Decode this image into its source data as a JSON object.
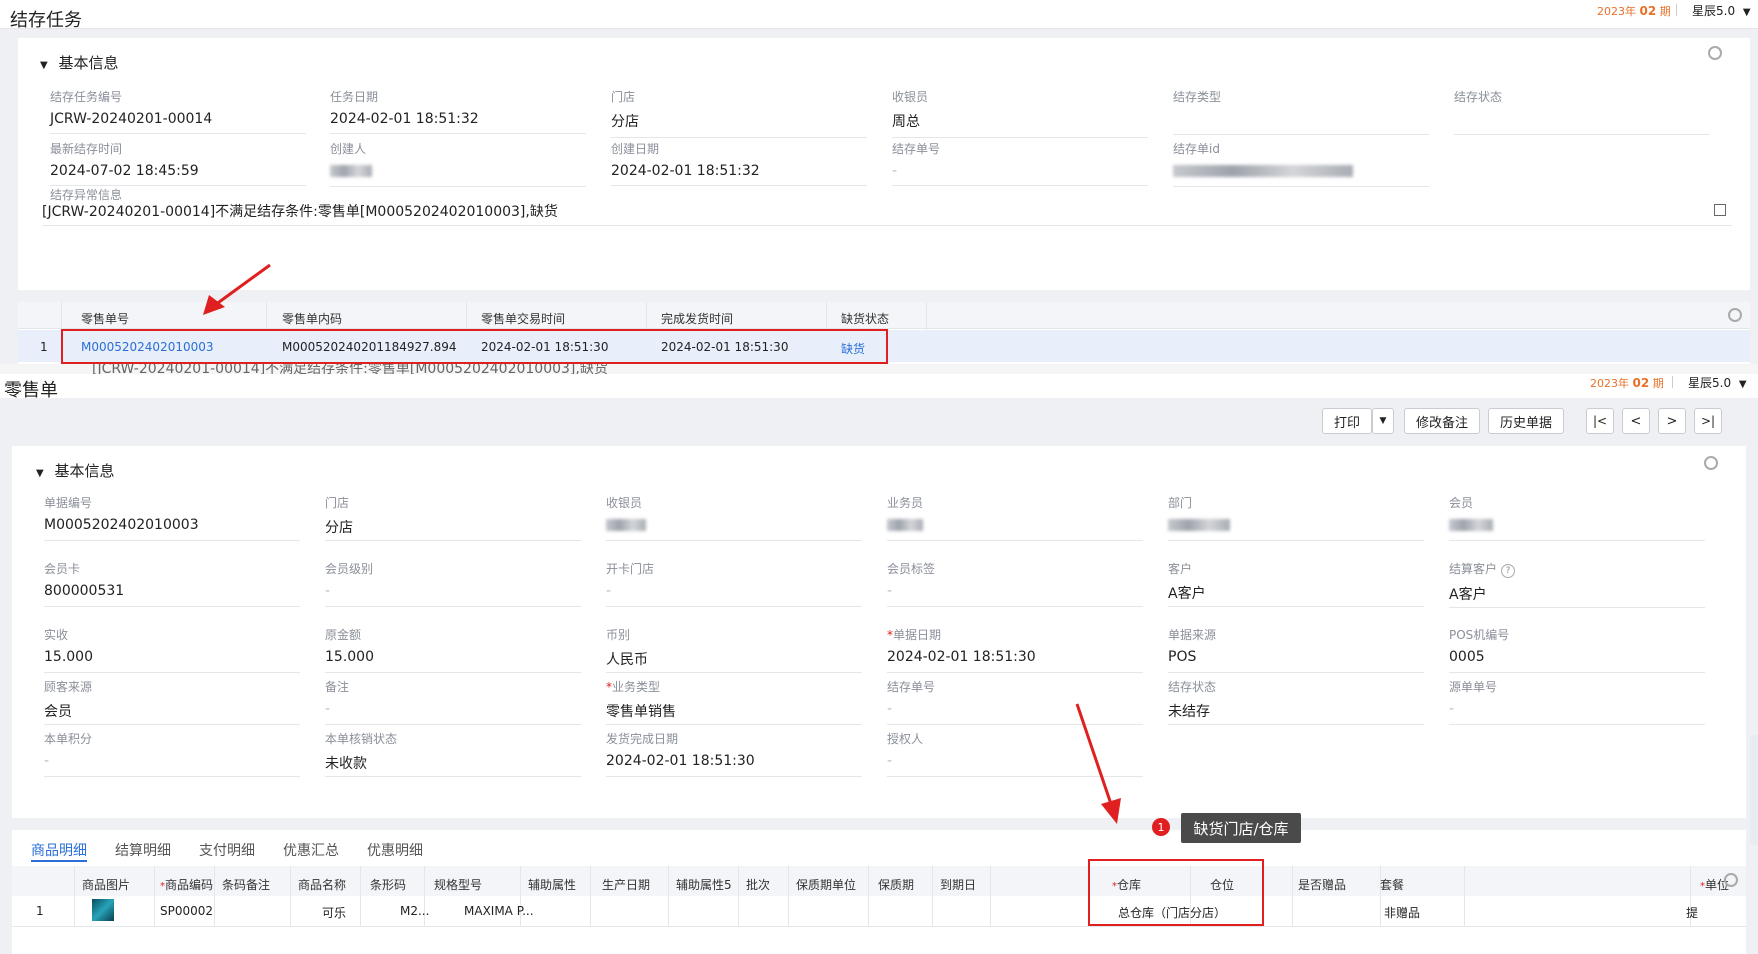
{
  "top": {
    "title": "结存任务",
    "period_year": "2023年",
    "period_num": "02",
    "period_unit": "期",
    "version": "星辰5.0",
    "section_title": "基本信息",
    "fields": [
      {
        "label": "结存任务编号",
        "value": "JCRW-20240201-00014"
      },
      {
        "label": "任务日期",
        "value": "2024-02-01 18:51:32"
      },
      {
        "label": "门店",
        "value": "分店"
      },
      {
        "label": "收银员",
        "value": "周总"
      },
      {
        "label": "结存类型",
        "value": ""
      },
      {
        "label": "结存状态",
        "value": ""
      },
      {
        "label": "最新结存时间",
        "value": "2024-07-02 18:45:59"
      },
      {
        "label": "创建人",
        "value": ""
      },
      {
        "label": "创建日期",
        "value": "2024-02-01 18:51:32"
      },
      {
        "label": "结存单号",
        "value": "-"
      },
      {
        "label": "结存单id",
        "value": ""
      }
    ],
    "error_label": "结存异常信息",
    "error_text": "[JCRW-20240201-00014]不满足结存条件:零售单[M0005202402010003],缺货",
    "table": {
      "headers": [
        "零售单号",
        "零售单内码",
        "零售单交易时间",
        "完成发货时间",
        "缺货状态"
      ],
      "rows": [
        {
          "index": "1",
          "order_no": "M0005202402010003",
          "inner_code": "M00052024020118492​7.894...",
          "trade_time": "2024-02-01 18:51:30",
          "ship_time": "2024-02-01 18:51:30",
          "status": "缺货"
        }
      ]
    },
    "overlap_text": "[JCRW-20240201-00014]不满足结存条件:零售单[M0005202402010003],缺货"
  },
  "bottom": {
    "title": "零售单",
    "period_year": "2023年",
    "period_num": "02",
    "period_unit": "期",
    "version": "星辰5.0",
    "toolbar": {
      "print": "打印",
      "edit_note": "修改备注",
      "history": "历史单据"
    },
    "section_title": "基本信息",
    "fields": [
      {
        "label": "单据编号",
        "value": "M0005202402010003"
      },
      {
        "label": "门店",
        "value": "分店"
      },
      {
        "label": "收银员",
        "value": ""
      },
      {
        "label": "业务员",
        "value": ""
      },
      {
        "label": "部门",
        "value": ""
      },
      {
        "label": "会员",
        "value": ""
      },
      {
        "label": "会员卡",
        "value": "800000531"
      },
      {
        "label": "会员级别",
        "value": "-"
      },
      {
        "label": "开卡门店",
        "value": "-"
      },
      {
        "label": "会员标签",
        "value": "-"
      },
      {
        "label": "客户",
        "value": "A客户"
      },
      {
        "label": "结算客户",
        "value": "A客户"
      },
      {
        "label": "实收",
        "value": "15.000"
      },
      {
        "label": "原金额",
        "value": "15.000"
      },
      {
        "label": "币别",
        "value": "人民币"
      },
      {
        "label": "单据日期",
        "value": "2024-02-01 18:51:30"
      },
      {
        "label": "单据来源",
        "value": "POS"
      },
      {
        "label": "POS机编号",
        "value": "0005"
      },
      {
        "label": "顾客来源",
        "value": "会员"
      },
      {
        "label": "备注",
        "value": "-"
      },
      {
        "label": "业务类型",
        "value": "零售单销售"
      },
      {
        "label": "结存单号",
        "value": "-"
      },
      {
        "label": "结存状态",
        "value": "未结存"
      },
      {
        "label": "源单单号",
        "value": "-"
      },
      {
        "label": "本单积分",
        "value": "-"
      },
      {
        "label": "本单核销状态",
        "value": "未收款"
      },
      {
        "label": "发货完成日期",
        "value": "2024-02-01 18:51:30"
      },
      {
        "label": "授权人",
        "value": "-"
      }
    ],
    "tabs": [
      "商品明细",
      "结算明细",
      "支付明细",
      "优惠汇总",
      "优惠明细"
    ],
    "tooltip": {
      "badge": "1",
      "text": "缺货门店/仓库"
    },
    "table": {
      "headers": [
        "商品图片",
        "商品编码",
        "条码备注",
        "商品名称",
        "条形码",
        "规格型号",
        "辅助属性",
        "生产日期",
        "辅助属性5",
        "批次",
        "保质期单位",
        "保质期",
        "到期日",
        "仓库",
        "仓位",
        "是否赠品",
        "套餐",
        "单位"
      ],
      "row": {
        "index": "1",
        "code": "SP00002",
        "name": "可乐",
        "barcode": "M2...",
        "spec": "MAXIMA P...",
        "warehouse": "总仓库（门店分店）",
        "gift": "非赠品",
        "unit": "提"
      }
    }
  },
  "colors": {
    "accent": "#2b6fd6",
    "highlight": "#e02020",
    "period": "#e8702a"
  }
}
